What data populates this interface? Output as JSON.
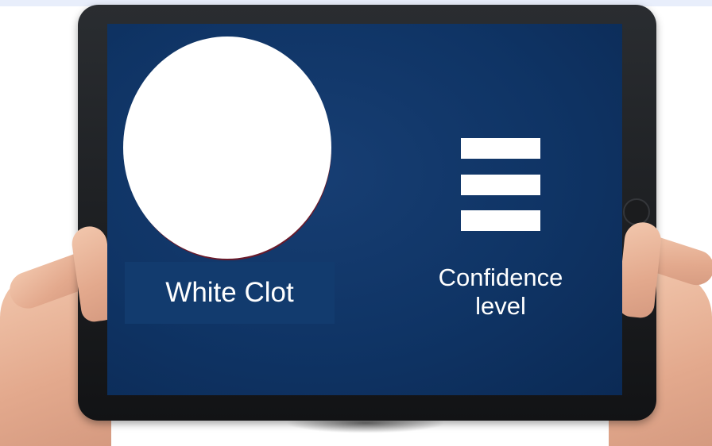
{
  "screen": {
    "result_label": "White Clot",
    "confidence_line1": "Confidence",
    "confidence_line2": "level",
    "menu_icon": "hamburger-menu-icon"
  },
  "colors": {
    "screen_background": "#0f3465",
    "circle": "#ffffff",
    "text": "#ffffff"
  }
}
